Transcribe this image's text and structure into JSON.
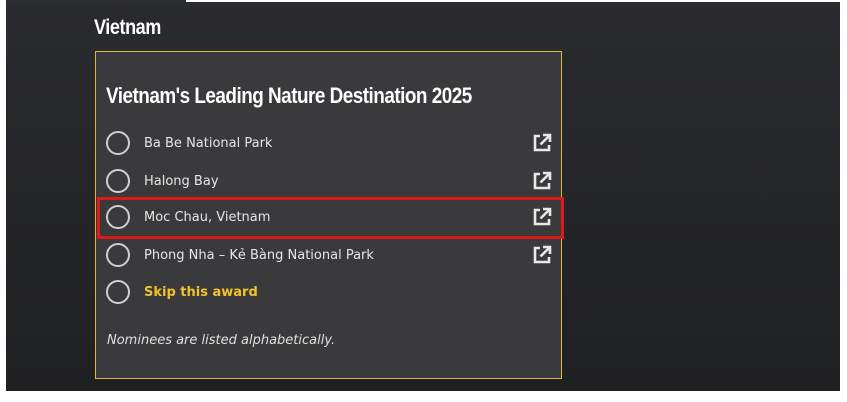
{
  "section": {
    "title": "Vietnam"
  },
  "award": {
    "title": "Vietnam's Leading Nature Destination 2025",
    "nominees": [
      {
        "label": "Ba Be National Park",
        "link_icon": "external-link-icon"
      },
      {
        "label": "Halong Bay",
        "link_icon": "external-link-icon"
      },
      {
        "label": "Moc Chau, Vietnam",
        "link_icon": "external-link-icon"
      },
      {
        "label": "Phong Nha – Kẻ Bàng National Park",
        "link_icon": "external-link-icon"
      }
    ],
    "skip_label": "Skip this award",
    "note": "Nominees are listed alphabetically."
  },
  "colors": {
    "background": "#2a2b2e",
    "card_background": "#3a3a3c",
    "card_border": "#d8b93a",
    "skip_text": "#f2c12e",
    "highlight": "#e01818"
  }
}
